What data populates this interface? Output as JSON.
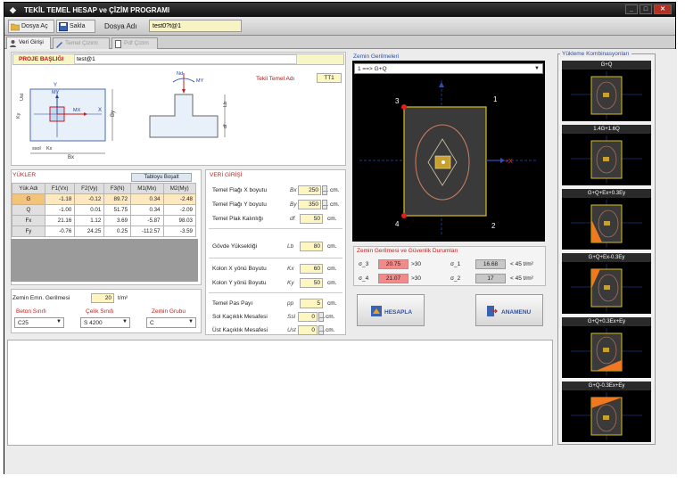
{
  "window": {
    "title": "TEKİL TEMEL HESAP ve ÇİZİM PROGRAMI"
  },
  "toolbar": {
    "open_label": "Dosya Aç",
    "save_label": "Sakla",
    "file_name_label": "Dosya Adı",
    "file_name_value": "test0?t@1"
  },
  "tabs": [
    {
      "label": "Veri Girişi"
    },
    {
      "label": "Temel Çizimi"
    },
    {
      "label": "Pdf Çizim"
    }
  ],
  "project": {
    "label": "PROJE BAŞLIĞI",
    "value": "test@1",
    "footing_name_label": "Tekil Temel Adı",
    "footing_name_value": "TT1"
  },
  "plan_diagram": {
    "labels": [
      "MY",
      "MX",
      "X",
      "Y",
      "Bx",
      "By",
      "Kx",
      "Ky",
      "Ust",
      "ssol",
      "Kx",
      "Bx"
    ]
  },
  "section_diagram": {
    "labels": [
      "Nd",
      "MY",
      "Lb",
      "df"
    ]
  },
  "loads": {
    "title": "YÜKLER",
    "table_button": "Tabloyu Boşalt",
    "headers": [
      "Yük Adı",
      "F1(Vx)",
      "F2(Vy)",
      "F3(N)",
      "M1(Mx)",
      "M2(My)"
    ],
    "rows": [
      [
        "G",
        "-1.18",
        "-0.12",
        "89.72",
        "0.34",
        "-2.48"
      ],
      [
        "Q",
        "-1.00",
        "0.01",
        "51.75",
        "0.34",
        "-2.09"
      ],
      [
        "Fx",
        "21.16",
        "1.12",
        "3.69",
        "-5.87",
        "98.03"
      ],
      [
        "Fy",
        "-0.76",
        "24.25",
        "0.25",
        "-112.57",
        "-3.59"
      ]
    ]
  },
  "soil": {
    "stress_label": "Zemin Emn. Gerilmesi",
    "stress_value": "20",
    "stress_unit": "t/m²",
    "concrete_label": "Beton Sınıfı",
    "concrete_value": "C25",
    "steel_label": "Çelik Sınıfı",
    "steel_value": "S 4200",
    "group_label": "Zemin Grubu",
    "group_value": "C"
  },
  "input": {
    "title": "VERİ GİRİŞİ",
    "fields": [
      {
        "label": "Temel Flağı  X boyutu",
        "sym": "Bx",
        "value": "250",
        "unit": "cm."
      },
      {
        "label": "Temel Flağı  Y boyutu",
        "sym": "By",
        "value": "350",
        "unit": "cm."
      },
      {
        "label": "Temel Plak Kalınlığı",
        "sym": "df",
        "value": "50",
        "unit": "cm."
      },
      {
        "label": "Gövde Yüksekliği",
        "sym": "Lb",
        "value": "80",
        "unit": "cm."
      },
      {
        "label": "Kolon  X yönü Boyutu",
        "sym": "Kx",
        "value": "60",
        "unit": "cm."
      },
      {
        "label": "Kolon  Y yönü Boyutu",
        "sym": "Ky",
        "value": "50",
        "unit": "cm."
      },
      {
        "label": "Temel Pas Payı",
        "sym": "pp",
        "value": "5",
        "unit": "cm."
      },
      {
        "label": "Sol Kaçıklık Mesafesi",
        "sym": "Ssl",
        "value": "0",
        "unit": "cm."
      },
      {
        "label": "Üst Kaçıklık Mesafesi",
        "sym": "Ust",
        "value": "0",
        "unit": "cm."
      }
    ]
  },
  "soil_stress": {
    "title": "Zemin Gerilmeleri",
    "combo_value": "1 ==> G+Q",
    "corners": [
      "3",
      "1",
      "4",
      "2"
    ],
    "axis_label": "+X"
  },
  "checks": {
    "title": "Zemin Gerilmesi ve Güvenlik Durumları",
    "items": [
      {
        "sym": "σ_3",
        "value": "20.75",
        "cmp": ">30",
        "status": "red"
      },
      {
        "sym": "σ_4",
        "value": "21.07",
        "cmp": ">30",
        "status": "red"
      },
      {
        "sym": "σ_1",
        "value": "16.68",
        "cmp": "< 45 t/m²",
        "status": "grey"
      },
      {
        "sym": "σ_2",
        "value": "17",
        "cmp": "< 45 t/m²",
        "status": "grey"
      }
    ]
  },
  "buttons": {
    "calc": "HESAPLA",
    "main_menu": "ANAMENU"
  },
  "load_combos": {
    "title": "Yükleme Kombinasyonları",
    "items": [
      {
        "label": "G+Q"
      },
      {
        "label": "1.4G+1.6Q"
      },
      {
        "label": "G+Q+Ex+0.3Ey"
      },
      {
        "label": "G+Q+Ex-0.3Ey"
      },
      {
        "label": "G+Q+0.3Ex+Ey"
      },
      {
        "label": "G+Q-0.3Ex+Ey"
      }
    ]
  },
  "colors": {
    "accent_red": "#c02020",
    "input_yellow": "#fdf6c0",
    "plot_bg": "#000000",
    "footing_outline": "#d8c020",
    "stress_ellipse": "#d08060",
    "load_fill": "#f07820"
  }
}
